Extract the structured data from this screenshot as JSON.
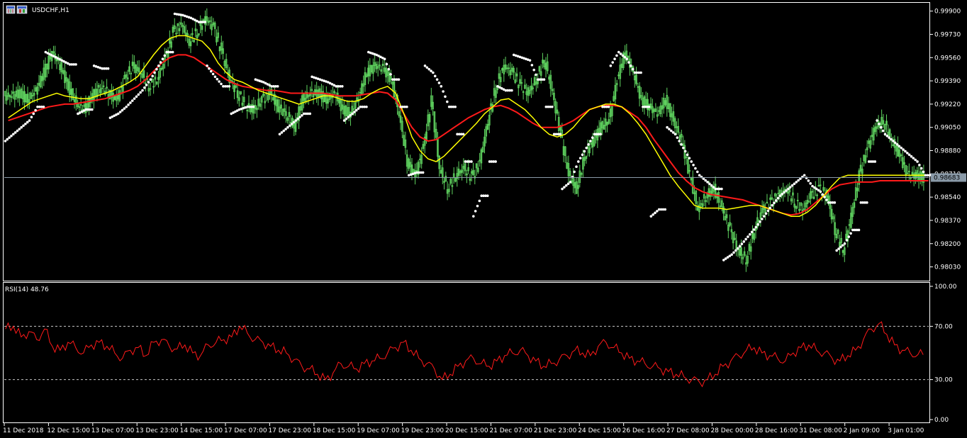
{
  "header": {
    "symbol_label": "USDCHF,H1",
    "icon": "candlestick-chart-icon"
  },
  "colors": {
    "background": "#000000",
    "frame": "#ffffff",
    "candle": "#5fd35f",
    "ma_fast": "#ffff00",
    "ma_slow": "#ff1a1a",
    "sar": "#ffffff",
    "rsi": "#ff1a1a",
    "price_line": "#8a9aa8",
    "price_tag_bg": "#8a9aa8"
  },
  "chart_data": [
    {
      "type": "line",
      "name": "USDCHF,H1",
      "ylim": [
        0.9795,
        0.9995
      ],
      "yticks": [
        0.999,
        0.9973,
        0.9956,
        0.9939,
        0.9922,
        0.9905,
        0.9888,
        0.9871,
        0.9854,
        0.9837,
        0.982,
        0.9803
      ],
      "ytick_labels": [
        "0.99900",
        "0.99730",
        "0.99560",
        "0.99390",
        "0.99220",
        "0.99050",
        "0.98880",
        "0.98710",
        "0.98540",
        "0.98370",
        "0.98200",
        "0.98030"
      ],
      "current_price": 0.98683,
      "current_price_label": "0.98683",
      "xtick_labels": [
        "11 Dec 2018",
        "12 Dec 15:00",
        "13 Dec 07:00",
        "13 Dec 23:00",
        "14 Dec 15:00",
        "17 Dec 07:00",
        "17 Dec 23:00",
        "18 Dec 15:00",
        "19 Dec 07:00",
        "19 Dec 23:00",
        "20 Dec 15:00",
        "21 Dec 07:00",
        "21 Dec 23:00",
        "24 Dec 15:00",
        "26 Dec 16:00",
        "27 Dec 08:00",
        "28 Dec 00:00",
        "28 Dec 16:00",
        "31 Dec 08:00",
        "2 Jan 09:00",
        "3 Jan 01:00"
      ],
      "series": [
        {
          "kind": "close",
          "values": [
            0.9928,
            0.993,
            0.9925,
            0.9932,
            0.9945,
            0.996,
            0.995,
            0.9935,
            0.9922,
            0.9918,
            0.9928,
            0.9935,
            0.993,
            0.9925,
            0.994,
            0.995,
            0.9945,
            0.9935,
            0.994,
            0.9955,
            0.9975,
            0.998,
            0.9968,
            0.9975,
            0.9985,
            0.9978,
            0.996,
            0.994,
            0.993,
            0.992,
            0.9918,
            0.9925,
            0.993,
            0.992,
            0.9915,
            0.9905,
            0.9925,
            0.993,
            0.993,
            0.9925,
            0.993,
            0.9918,
            0.9915,
            0.9928,
            0.9945,
            0.995,
            0.9948,
            0.994,
            0.9915,
            0.988,
            0.987,
            0.989,
            0.9925,
            0.9875,
            0.986,
            0.987,
            0.9875,
            0.9868,
            0.988,
            0.991,
            0.9935,
            0.995,
            0.9945,
            0.9935,
            0.993,
            0.994,
            0.9955,
            0.993,
            0.99,
            0.987,
            0.986,
            0.9885,
            0.9895,
            0.9905,
            0.991,
            0.994,
            0.996,
            0.9945,
            0.9925,
            0.992,
            0.9915,
            0.9925,
            0.991,
            0.9895,
            0.987,
            0.9845,
            0.9855,
            0.986,
            0.9845,
            0.983,
            0.9815,
            0.9808,
            0.983,
            0.9845,
            0.985,
            0.9855,
            0.986,
            0.985,
            0.9845,
            0.9855,
            0.986,
            0.9855,
            0.983,
            0.9815,
            0.984,
            0.987,
            0.989,
            0.9905,
            0.991,
            0.9895,
            0.9885,
            0.987,
            0.987,
            0.9868
          ]
        },
        {
          "kind": "ma_fast",
          "values": [
            0.9912,
            0.9916,
            0.992,
            0.9924,
            0.9926,
            0.9928,
            0.993,
            0.9928,
            0.9927,
            0.9926,
            0.9926,
            0.9928,
            0.993,
            0.9932,
            0.9935,
            0.9938,
            0.9942,
            0.995,
            0.9958,
            0.9965,
            0.997,
            0.9972,
            0.9972,
            0.997,
            0.9968,
            0.9962,
            0.9952,
            0.9945,
            0.994,
            0.9938,
            0.9935,
            0.9932,
            0.993,
            0.9928,
            0.9926,
            0.9924,
            0.9922,
            0.9924,
            0.9926,
            0.9928,
            0.9928,
            0.9926,
            0.9924,
            0.9924,
            0.9926,
            0.993,
            0.9933,
            0.9935,
            0.993,
            0.9915,
            0.9898,
            0.9888,
            0.9882,
            0.988,
            0.9884,
            0.989,
            0.9896,
            0.9902,
            0.9908,
            0.9915,
            0.992,
            0.9925,
            0.9926,
            0.9922,
            0.9918,
            0.9912,
            0.9905,
            0.99,
            0.9898,
            0.99,
            0.9905,
            0.9912,
            0.9918,
            0.992,
            0.9922,
            0.9922,
            0.992,
            0.9915,
            0.9908,
            0.99,
            0.989,
            0.988,
            0.987,
            0.9862,
            0.9855,
            0.9848,
            0.9846,
            0.9846,
            0.9846,
            0.9845,
            0.9846,
            0.9847,
            0.9848,
            0.9848,
            0.9846,
            0.9844,
            0.9842,
            0.984,
            0.984,
            0.9843,
            0.9848,
            0.9855,
            0.9862,
            0.9868,
            0.987,
            0.987,
            0.987,
            0.987,
            0.987,
            0.987,
            0.987,
            0.987,
            0.987,
            0.987,
            0.987
          ]
        },
        {
          "kind": "ma_slow",
          "values": [
            0.991,
            0.9912,
            0.9914,
            0.9916,
            0.9918,
            0.992,
            0.9921,
            0.9922,
            0.9922,
            0.9923,
            0.9924,
            0.9925,
            0.9926,
            0.9928,
            0.993,
            0.9932,
            0.9935,
            0.994,
            0.9946,
            0.9952,
            0.9956,
            0.9958,
            0.9958,
            0.9956,
            0.9952,
            0.9948,
            0.9944,
            0.994,
            0.9937,
            0.9935,
            0.9934,
            0.9933,
            0.9932,
            0.9932,
            0.9931,
            0.993,
            0.993,
            0.993,
            0.993,
            0.993,
            0.9929,
            0.9928,
            0.9928,
            0.9928,
            0.9929,
            0.993,
            0.9931,
            0.993,
            0.9925,
            0.9915,
            0.9905,
            0.9898,
            0.9895,
            0.9896,
            0.99,
            0.9904,
            0.9908,
            0.9912,
            0.9915,
            0.9918,
            0.992,
            0.9921,
            0.9919,
            0.9916,
            0.9912,
            0.9908,
            0.9905,
            0.9905,
            0.9905,
            0.9907,
            0.991,
            0.9914,
            0.9918,
            0.992,
            0.9921,
            0.9921,
            0.992,
            0.9916,
            0.9912,
            0.9905,
            0.9896,
            0.9888,
            0.988,
            0.9872,
            0.9866,
            0.9861,
            0.9858,
            0.9856,
            0.9855,
            0.9854,
            0.9853,
            0.9852,
            0.985,
            0.9848,
            0.9846,
            0.9844,
            0.9842,
            0.9841,
            0.9842,
            0.9845,
            0.985,
            0.9855,
            0.986,
            0.9863,
            0.9864,
            0.9865,
            0.9865,
            0.9865,
            0.9866,
            0.9866,
            0.9866,
            0.9866,
            0.9866,
            0.9866,
            0.9866
          ]
        },
        {
          "kind": "sar",
          "values": [
            0.9895,
            0.99,
            0.9905,
            0.991,
            0.992,
            0.996,
            0.9957,
            0.9954,
            0.9951,
            0.9915,
            0.9918,
            0.995,
            0.9948,
            0.9912,
            0.9915,
            0.992,
            0.9926,
            0.9932,
            0.994,
            0.995,
            0.996,
            0.9988,
            0.9987,
            0.9985,
            0.9982,
            0.995,
            0.9942,
            0.9935,
            0.9915,
            0.9918,
            0.992,
            0.994,
            0.9938,
            0.9935,
            0.99,
            0.9905,
            0.991,
            0.9915,
            0.9942,
            0.994,
            0.9938,
            0.9935,
            0.991,
            0.9915,
            0.992,
            0.996,
            0.9958,
            0.9955,
            0.994,
            0.992,
            0.987,
            0.9872,
            0.995,
            0.9945,
            0.9935,
            0.992,
            0.99,
            0.988,
            0.984,
            0.9855,
            0.988,
            0.9935,
            0.9932,
            0.9958,
            0.9956,
            0.9954,
            0.994,
            0.992,
            0.99,
            0.986,
            0.9865,
            0.988,
            0.989,
            0.99,
            0.992,
            0.995,
            0.996,
            0.9955,
            0.9945,
            0.992,
            0.984,
            0.9845,
            0.9905,
            0.99,
            0.989,
            0.988,
            0.987,
            0.9865,
            0.986,
            0.9808,
            0.9812,
            0.9818,
            0.9825,
            0.9832,
            0.984,
            0.9848,
            0.9855,
            0.986,
            0.9865,
            0.987,
            0.9862,
            0.9858,
            0.985,
            0.9815,
            0.982,
            0.983,
            0.985,
            0.988,
            0.991,
            0.99,
            0.9895,
            0.989,
            0.9885,
            0.988,
            0.987
          ]
        }
      ]
    },
    {
      "type": "line",
      "name": "RSI(14)",
      "label": "RSI(14) 48.76",
      "ylim": [
        0,
        100
      ],
      "yticks": [
        100,
        70,
        30,
        0
      ],
      "ytick_labels": [
        "100.00",
        "70.00",
        "30.00",
        "0.00"
      ],
      "levels": [
        70,
        30
      ],
      "values": [
        68,
        70,
        62,
        66,
        60,
        68,
        55,
        52,
        58,
        54,
        50,
        56,
        58,
        55,
        50,
        46,
        52,
        54,
        48,
        58,
        60,
        55,
        53,
        56,
        50,
        48,
        56,
        58,
        60,
        62,
        70,
        65,
        60,
        58,
        55,
        52,
        50,
        45,
        40,
        38,
        34,
        30,
        35,
        42,
        40,
        38,
        42,
        44,
        46,
        50,
        54,
        58,
        52,
        46,
        42,
        38,
        30,
        34,
        40,
        44,
        46,
        42,
        40,
        44,
        48,
        50,
        52,
        48,
        44,
        40,
        42,
        45,
        48,
        52,
        50,
        48,
        55,
        58,
        54,
        50,
        46,
        44,
        42,
        40,
        38,
        36,
        34,
        32,
        30,
        28,
        30,
        34,
        40,
        44,
        48,
        52,
        54,
        50,
        48,
        46,
        44,
        50,
        54,
        56,
        52,
        50,
        46,
        44,
        48,
        52,
        60,
        68,
        72,
        64,
        56,
        52,
        50,
        48.76
      ]
    }
  ]
}
